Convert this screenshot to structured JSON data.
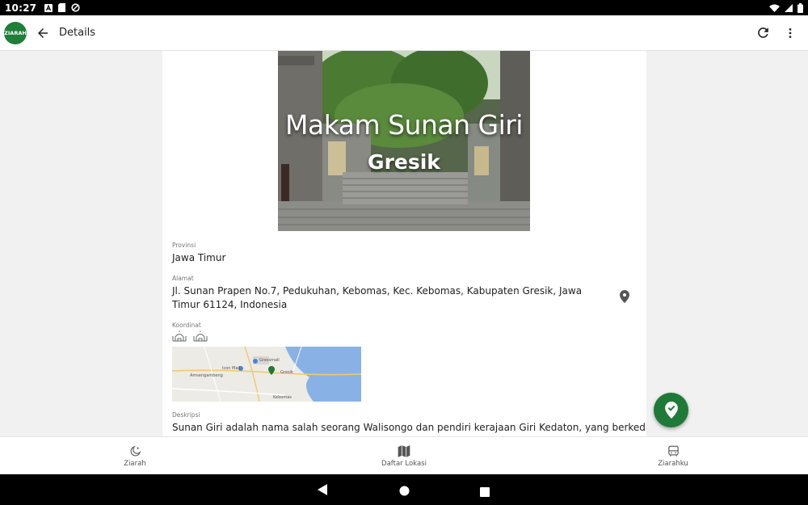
{
  "status": {
    "time": "10:27"
  },
  "appbar": {
    "logo_text": "ZIARAH",
    "title": "Details"
  },
  "hero": {
    "title": "Makam Sunan Giri",
    "subtitle": "Gresik"
  },
  "fields": {
    "provinsi_label": "Provinsi",
    "provinsi_value": "Jawa Timur",
    "alamat_label": "Alamat",
    "alamat_value": "Jl. Sunan Prapen No.7, Pedukuhan, Kebomas, Kec. Kebomas, Kabupaten Gresik, Jawa Timur 61124, Indonesia",
    "koordinat_label": "Koordinat",
    "deskripsi_label": "Deskripsi",
    "deskripsi_value": "Sunan Giri adalah nama salah seorang Walisongo dan pendiri kerajaan Giri Kedaton, yang berkedudukan di"
  },
  "map": {
    "labels": {
      "gressmall": "Gressmall",
      "icon_mall": "Icon Mall",
      "gresik": "Gresik",
      "amsengambeng": "Amsengambeng",
      "kebomas": "Kebomas"
    }
  },
  "bottomnav": {
    "items": [
      {
        "label": "Ziarah"
      },
      {
        "label": "Daftar Lokasi"
      },
      {
        "label": "Ziarahku"
      }
    ]
  },
  "colors": {
    "brand_green": "#1f7a37",
    "icon_gray": "#555555"
  },
  "icons": {
    "back": "arrow-left-icon",
    "refresh": "refresh-icon",
    "more": "more-vert-icon",
    "pin": "location-pin-icon",
    "mosque": "mosque-icon",
    "fab": "check-pin-icon",
    "ziarah": "moon-star-icon",
    "daftar": "map-icon",
    "ziarahku": "bus-icon"
  }
}
